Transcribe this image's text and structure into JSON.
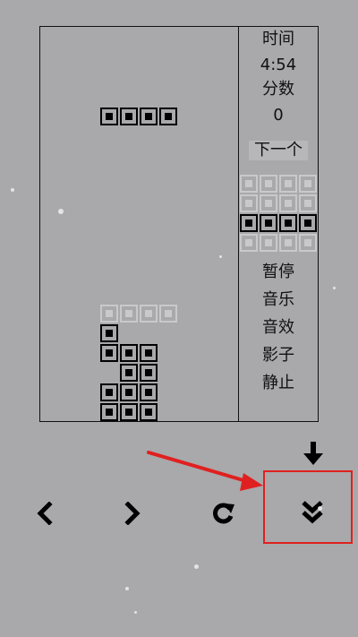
{
  "side_panel": {
    "time_label": "时间",
    "time_value": "4:54",
    "score_label": "分数",
    "score_value": "0",
    "next_label": "下一个",
    "menu": [
      "暂停",
      "音乐",
      "音效",
      "影子",
      "静止"
    ]
  },
  "controls": {
    "left": "chevron-left-icon",
    "right": "chevron-right-icon",
    "rotate": "rotate-icon",
    "soft_drop": "arrow-down-icon",
    "hard_drop": "double-chevron-down-icon"
  },
  "colors": {
    "background": "#a9a8aa",
    "block": "#000000",
    "ghost": "#c9c8ca",
    "highlight": "#e02020"
  }
}
